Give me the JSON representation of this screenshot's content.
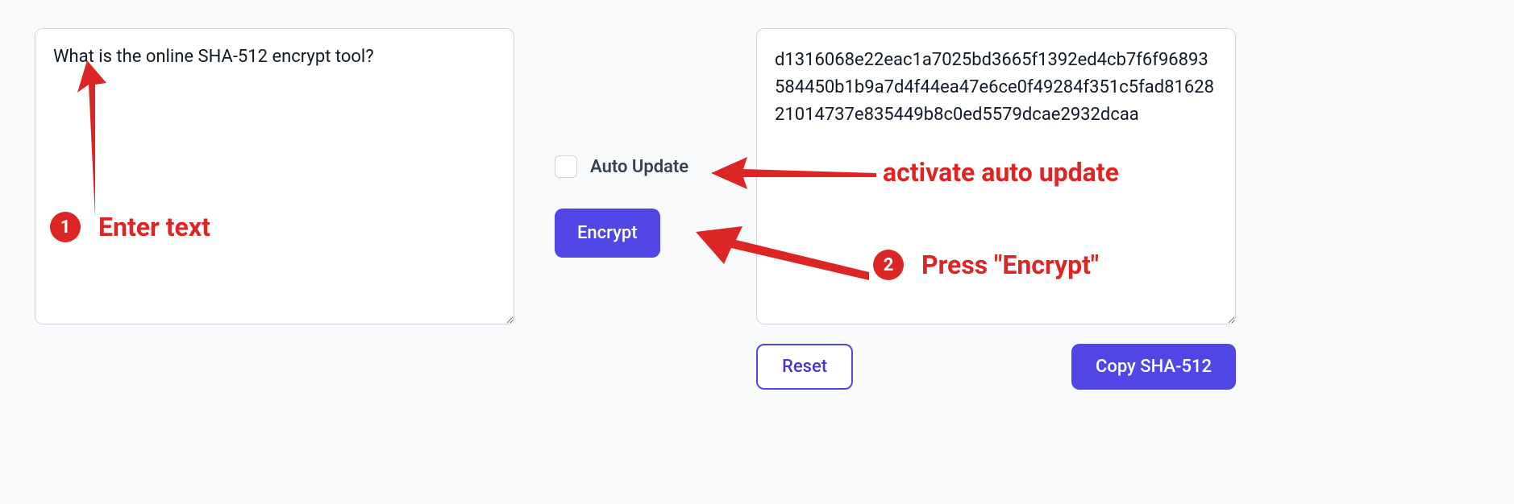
{
  "input": {
    "value": "What is the online SHA-512 encrypt tool?"
  },
  "middle": {
    "auto_update_label": "Auto Update",
    "encrypt_label": "Encrypt"
  },
  "output": {
    "value": "d1316068e22eac1a7025bd3665f1392ed4cb7f6f96893584450b1b9a7d4f44ea47e6ce0f49284f351c5fad8162821014737e835449b8c0ed5579dcae2932dcaa"
  },
  "buttons": {
    "reset_label": "Reset",
    "copy_label": "Copy SHA-512"
  },
  "annotations": {
    "step1_num": "1",
    "step1_text": "Enter text",
    "step2_num": "2",
    "step2_text": "Press \"Encrypt\"",
    "auto_update_text": "activate auto update"
  },
  "colors": {
    "primary": "#4f46e5",
    "annotation": "#dc2626"
  }
}
